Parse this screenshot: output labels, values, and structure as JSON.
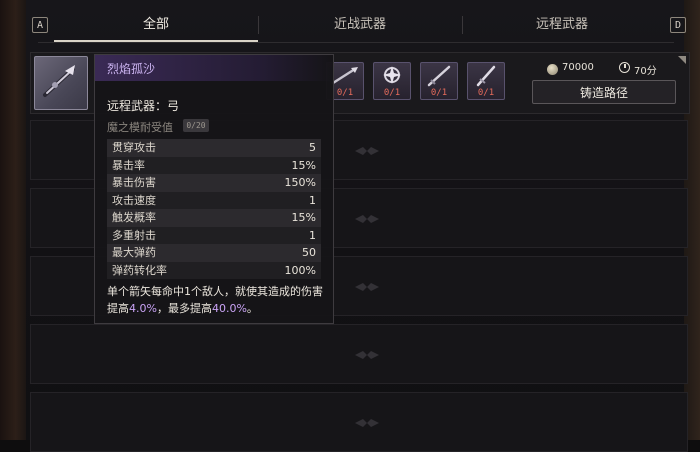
{
  "tabs": {
    "left_key": "A",
    "right_key": "D",
    "items": [
      {
        "label": "全部",
        "active": true
      },
      {
        "label": "近战武器",
        "active": false
      },
      {
        "label": "远程武器",
        "active": false
      }
    ]
  },
  "recipe": {
    "materials": [
      {
        "count": "0/1"
      },
      {
        "count": "0/1"
      },
      {
        "count": "0/1"
      },
      {
        "count": "0/1"
      }
    ],
    "gold": "70000",
    "time": "70分",
    "forge_button": "铸造路径"
  },
  "tooltip": {
    "name": "烈焰孤沙",
    "type": "远程武器：弓",
    "blessing_label": "魔之模耐受值",
    "blessing_value": "0/20",
    "stats": [
      {
        "name": "贯穿攻击",
        "value": "5"
      },
      {
        "name": "暴击率",
        "value": "15%"
      },
      {
        "name": "暴击伤害",
        "value": "150%"
      },
      {
        "name": "攻击速度",
        "value": "1"
      },
      {
        "name": "触发概率",
        "value": "15%"
      },
      {
        "name": "多重射击",
        "value": "1"
      },
      {
        "name": "最大弹药",
        "value": "50"
      },
      {
        "name": "弹药转化率",
        "value": "100%"
      }
    ],
    "desc_part1": "单个箭矢每命中1个敌人，就使其造成的伤害提高",
    "desc_hl1": "4.0%",
    "desc_part2": "，最多提高",
    "desc_hl2": "40.0%",
    "desc_part3": "。"
  },
  "colors": {
    "accent_purple": "#c9a3f5",
    "missing_material": "#e56b5b"
  }
}
